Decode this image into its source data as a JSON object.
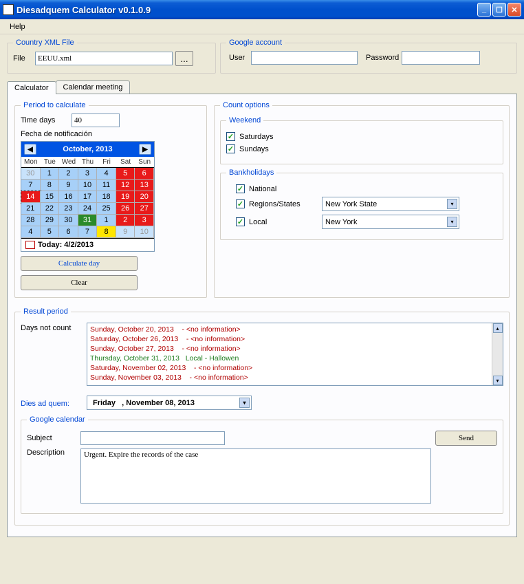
{
  "titlebar": {
    "title": "Diesadquem Calculator v0.1.0.9"
  },
  "menubar": {
    "help": "Help"
  },
  "countryFile": {
    "legend": "Country XML File",
    "label": "File",
    "value": "EEUU.xml",
    "browse": "..."
  },
  "google": {
    "legend": "Google account",
    "userLabel": "User",
    "userValue": "",
    "passLabel": "Password",
    "passValue": ""
  },
  "tabs": {
    "calculator": "Calculator",
    "calendarMeeting": "Calendar meeting"
  },
  "period": {
    "legend": "Period to calculate",
    "timeDaysLabel": "Time days",
    "timeDaysValue": "40",
    "fechaLabel": "Fecha de notificación",
    "monthTitle": "October, 2013",
    "dow": [
      "Mon",
      "Tue",
      "Wed",
      "Thu",
      "Fri",
      "Sat",
      "Sun"
    ],
    "todayLabel": "Today: 4/2/2013",
    "calculateBtn": "Calculate day",
    "clearBtn": "Clear",
    "weeks": [
      [
        {
          "n": "30",
          "c": "other"
        },
        {
          "n": "1",
          "c": "blue"
        },
        {
          "n": "2",
          "c": "blue"
        },
        {
          "n": "3",
          "c": "blue"
        },
        {
          "n": "4",
          "c": "blue"
        },
        {
          "n": "5",
          "c": "red"
        },
        {
          "n": "6",
          "c": "red"
        }
      ],
      [
        {
          "n": "7",
          "c": "blue"
        },
        {
          "n": "8",
          "c": "blue"
        },
        {
          "n": "9",
          "c": "blue"
        },
        {
          "n": "10",
          "c": "blue"
        },
        {
          "n": "11",
          "c": "blue"
        },
        {
          "n": "12",
          "c": "red"
        },
        {
          "n": "13",
          "c": "red"
        }
      ],
      [
        {
          "n": "14",
          "c": "selected"
        },
        {
          "n": "15",
          "c": "blue"
        },
        {
          "n": "16",
          "c": "blue"
        },
        {
          "n": "17",
          "c": "blue"
        },
        {
          "n": "18",
          "c": "blue"
        },
        {
          "n": "19",
          "c": "red"
        },
        {
          "n": "20",
          "c": "red"
        }
      ],
      [
        {
          "n": "21",
          "c": "blue"
        },
        {
          "n": "22",
          "c": "blue"
        },
        {
          "n": "23",
          "c": "blue"
        },
        {
          "n": "24",
          "c": "blue"
        },
        {
          "n": "25",
          "c": "blue"
        },
        {
          "n": "26",
          "c": "red"
        },
        {
          "n": "27",
          "c": "red"
        }
      ],
      [
        {
          "n": "28",
          "c": "blue"
        },
        {
          "n": "29",
          "c": "blue"
        },
        {
          "n": "30",
          "c": "blue"
        },
        {
          "n": "31",
          "c": "green"
        },
        {
          "n": "1",
          "c": "blue"
        },
        {
          "n": "2",
          "c": "red"
        },
        {
          "n": "3",
          "c": "red"
        }
      ],
      [
        {
          "n": "4",
          "c": "blue"
        },
        {
          "n": "5",
          "c": "blue"
        },
        {
          "n": "6",
          "c": "blue"
        },
        {
          "n": "7",
          "c": "blue"
        },
        {
          "n": "8",
          "c": "yellow"
        },
        {
          "n": "9",
          "c": "other"
        },
        {
          "n": "10",
          "c": "other"
        }
      ]
    ]
  },
  "count": {
    "legend": "Count options",
    "weekendLegend": "Weekend",
    "saturdays": "Saturdays",
    "sundays": "Sundays",
    "bankLegend": "Bankholidays",
    "national": "National",
    "regions": "Regions/States",
    "local": "Local",
    "regionValue": "New York State",
    "localValue": "New York"
  },
  "result": {
    "legend": "Result period",
    "daysNotCountLabel": "Days not count",
    "lines": [
      {
        "text": "Sunday, October 20, 2013    - <no information>",
        "cls": "red"
      },
      {
        "text": "Saturday, October 26, 2013    - <no information>",
        "cls": "red"
      },
      {
        "text": "Sunday, October 27, 2013    - <no information>",
        "cls": "red"
      },
      {
        "text": "Thursday, October 31, 2013   Local - Hallowen",
        "cls": "green"
      },
      {
        "text": "Saturday, November 02, 2013    - <no information>",
        "cls": "red"
      },
      {
        "text": "Sunday, November 03, 2013    - <no information>",
        "cls": "red"
      }
    ],
    "diesLabel": "Dies ad quem:",
    "diesValue": "Friday   , November 08, 2013"
  },
  "gcal": {
    "legend": "Google calendar",
    "subjectLabel": "Subject",
    "subjectValue": "",
    "descLabel": "Description",
    "descValue": "Urgent. Expire the records of the case",
    "sendBtn": "Send"
  }
}
